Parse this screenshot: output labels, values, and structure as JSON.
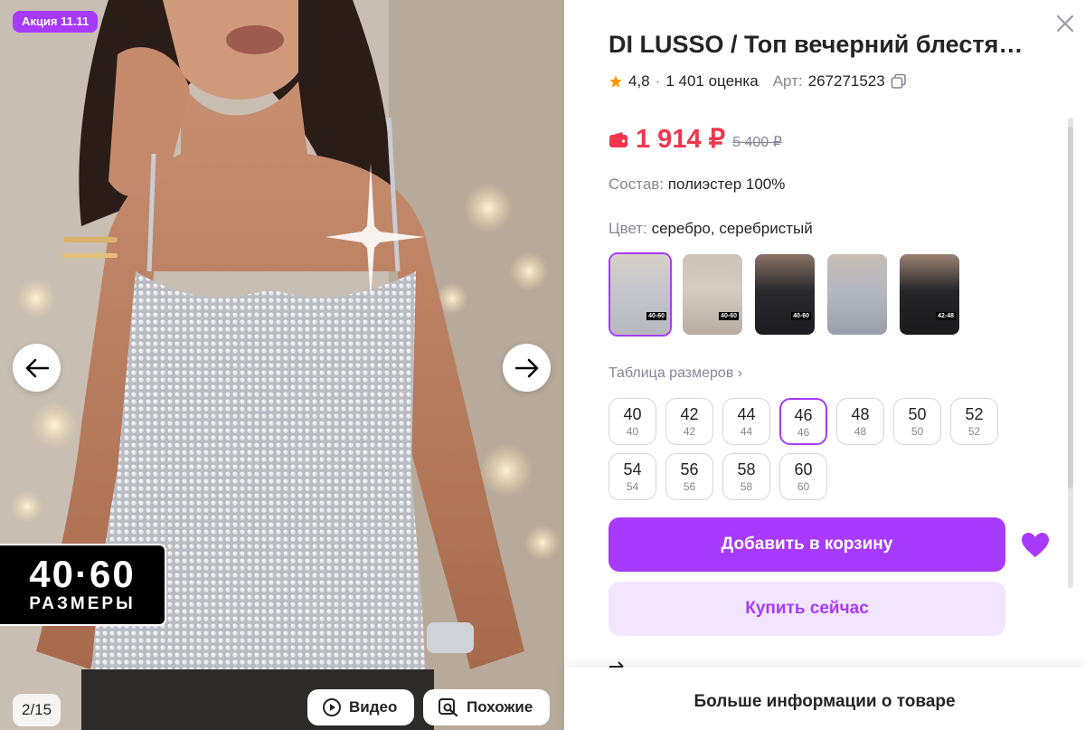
{
  "gallery": {
    "promo_badge": "Акция 11.11",
    "size_badge_big": "40·60",
    "size_badge_small": "РАЗМЕРЫ",
    "counter": "2/15",
    "video_label": "Видео",
    "similar_label": "Похожие"
  },
  "product": {
    "title": "DI LUSSO / Топ вечерний блестящий",
    "rating": "4,8",
    "reviews": "1 401 оценка",
    "art_label": "Арт:",
    "art": "267271523",
    "price": "1 914 ₽",
    "old_price": "5 400 ₽",
    "composition_label": "Состав:",
    "composition": "полиэстер 100%",
    "color_label": "Цвет:",
    "color": "серебро, серебристый",
    "thumbs": [
      {
        "label": "40-60",
        "selected": true
      },
      {
        "label": "40-60",
        "selected": false
      },
      {
        "label": "40-60",
        "selected": false
      },
      {
        "label": "",
        "selected": false
      },
      {
        "label": "42-48",
        "selected": false
      }
    ],
    "size_table_label": "Таблица размеров",
    "sizes": [
      {
        "size": "40",
        "ru": "40"
      },
      {
        "size": "42",
        "ru": "42"
      },
      {
        "size": "44",
        "ru": "44"
      },
      {
        "size": "46",
        "ru": "46"
      },
      {
        "size": "48",
        "ru": "48"
      },
      {
        "size": "50",
        "ru": "50"
      },
      {
        "size": "52",
        "ru": "52"
      },
      {
        "size": "54",
        "ru": "54"
      },
      {
        "size": "56",
        "ru": "56"
      },
      {
        "size": "58",
        "ru": "58"
      },
      {
        "size": "60",
        "ru": "60"
      }
    ],
    "selected_size": "46",
    "add_to_cart_label": "Добавить в корзину",
    "buy_now_label": "Купить сейчас",
    "more_info_label": "Больше информации о товаре"
  },
  "colors": {
    "accent": "#a73afd",
    "accent_light": "#f3e5ff",
    "price": "#f1364d",
    "star": "#ff9900"
  }
}
